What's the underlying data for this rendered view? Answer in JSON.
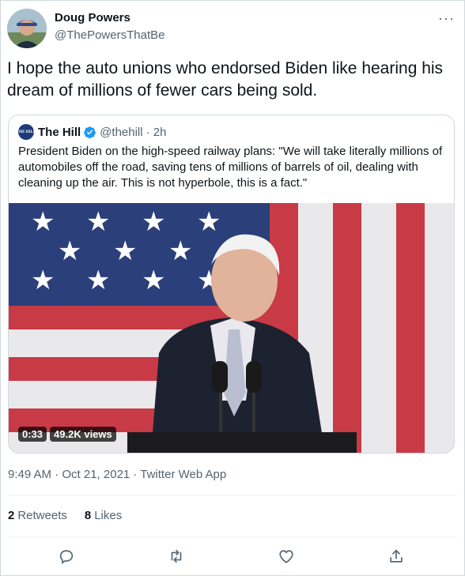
{
  "tweet": {
    "author_name": "Doug Powers",
    "author_handle": "@ThePowersThatBe",
    "text": "I hope the auto unions who endorsed Biden like hearing his dream of millions of fewer cars being sold.",
    "timestamp": "9:49 AM · Oct 21, 2021",
    "source": "Twitter Web App",
    "retweets_count": "2",
    "retweets_label": "Retweets",
    "likes_count": "8",
    "likes_label": "Likes"
  },
  "quote": {
    "logo_text": "THE HILL",
    "author_name": "The Hill",
    "author_handle": "@thehill",
    "age": "· 2h",
    "text": "President Biden on the high-speed railway plans: \"We will take literally millions of automobiles off the road, saving tens of millions of barrels of oil, dealing with cleaning up the air. This is not hyperbole, this is a fact.\"",
    "video_duration": "0:33",
    "video_views": "49.2K views"
  },
  "colors": {
    "verified": "#1d9bf0",
    "secondary_text": "#536471",
    "flag_blue": "#2b3f7a",
    "flag_red": "#c83a45"
  },
  "icons": [
    "more-icon",
    "verified-icon",
    "reply-icon",
    "retweet-icon",
    "like-icon",
    "share-icon"
  ]
}
